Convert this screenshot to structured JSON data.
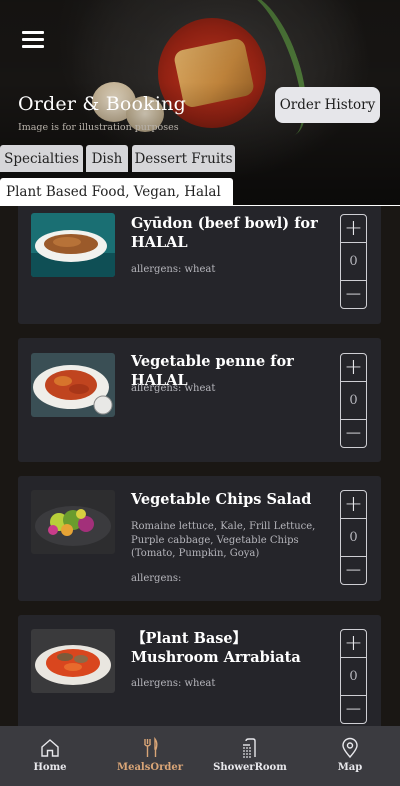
{
  "header": {
    "title": "Order & Booking",
    "subtitle": "Image is for illustration purposes",
    "history_label": "Order History"
  },
  "tabs": [
    {
      "label": "Specialties"
    },
    {
      "label": "Dish"
    },
    {
      "label": "Dessert Fruits"
    },
    {
      "label": "Plant Based Food, Vegan, Halal",
      "active": true
    }
  ],
  "items": [
    {
      "name": "Gyūdon (beef bowl) for HALAL",
      "description": "",
      "allergens": "allergens: wheat",
      "qty": "0"
    },
    {
      "name": "Vegetable penne for HALAL",
      "description": "",
      "allergens": "allergens: wheat",
      "qty": "0"
    },
    {
      "name": "Vegetable Chips Salad",
      "description": "Romaine lettuce, Kale, Frill Lettuce, Purple cabbage, Vegetable Chips (Tomato, Pumpkin, Goya)",
      "allergens": "allergens:",
      "qty": "0"
    },
    {
      "name": "【Plant Base】Mushroom Arrabiata",
      "description": "",
      "allergens": "allergens: wheat",
      "qty": "0"
    }
  ],
  "stepper": {
    "plus": "+",
    "minus": "−"
  },
  "nav": [
    {
      "label": "Home",
      "icon": "home-icon"
    },
    {
      "label": "MealsOrder",
      "icon": "fork-knife-icon",
      "active": true
    },
    {
      "label": "ShowerRoom",
      "icon": "shower-icon"
    },
    {
      "label": "Map",
      "icon": "map-pin-icon"
    }
  ],
  "colors": {
    "accent": "#d9a577",
    "card": "#25252a",
    "background": "#1a1714",
    "nav": "#3b3b40"
  }
}
